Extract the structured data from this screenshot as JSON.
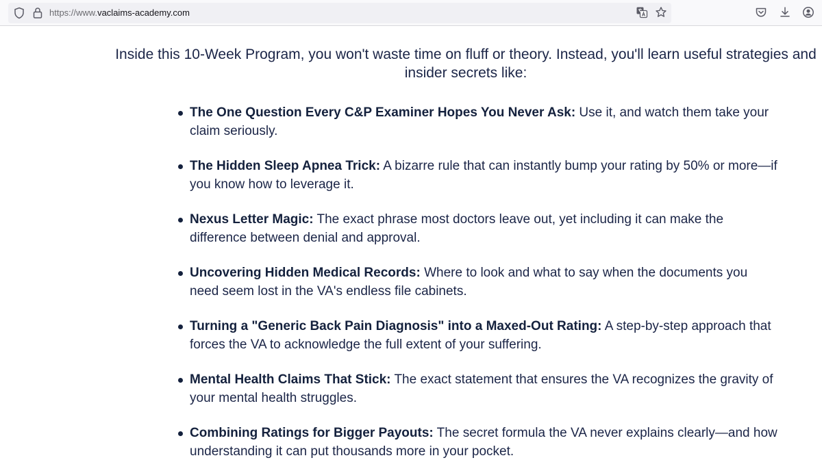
{
  "browser": {
    "url_protocol": "https://www.",
    "url_domain": "vaclaims-academy.com"
  },
  "intro": "Inside this 10-Week Program, you won't waste time on fluff or theory. Instead, you'll learn useful strategies and insider secrets like:",
  "items": [
    {
      "title": "The One Question Every C&P Examiner Hopes You Never Ask:",
      "text": " Use it, and watch them take your claim seriously."
    },
    {
      "title": "The Hidden Sleep Apnea Trick:",
      "text": " A bizarre rule that can instantly bump your rating by 50% or more—if you know how to leverage it."
    },
    {
      "title": "Nexus Letter Magic:",
      "text": " The exact phrase most doctors leave out, yet including it can make the difference between denial and approval."
    },
    {
      "title": "Uncovering Hidden Medical Records:",
      "text": " Where to look and what to say when the documents you need seem lost in the VA's endless file cabinets."
    },
    {
      "title": "Turning a \"Generic Back Pain Diagnosis\" into a Maxed-Out Rating:",
      "text": " A step-by-step approach that forces the VA to acknowledge the full extent of your suffering."
    },
    {
      "title": "Mental Health Claims That Stick:",
      "text": " The exact statement that ensures the VA recognizes the gravity of your mental health struggles."
    },
    {
      "title": "Combining Ratings for Bigger Payouts:",
      "text": " The secret formula the VA never explains clearly—and how understanding it can put thousands more in your pocket."
    }
  ]
}
